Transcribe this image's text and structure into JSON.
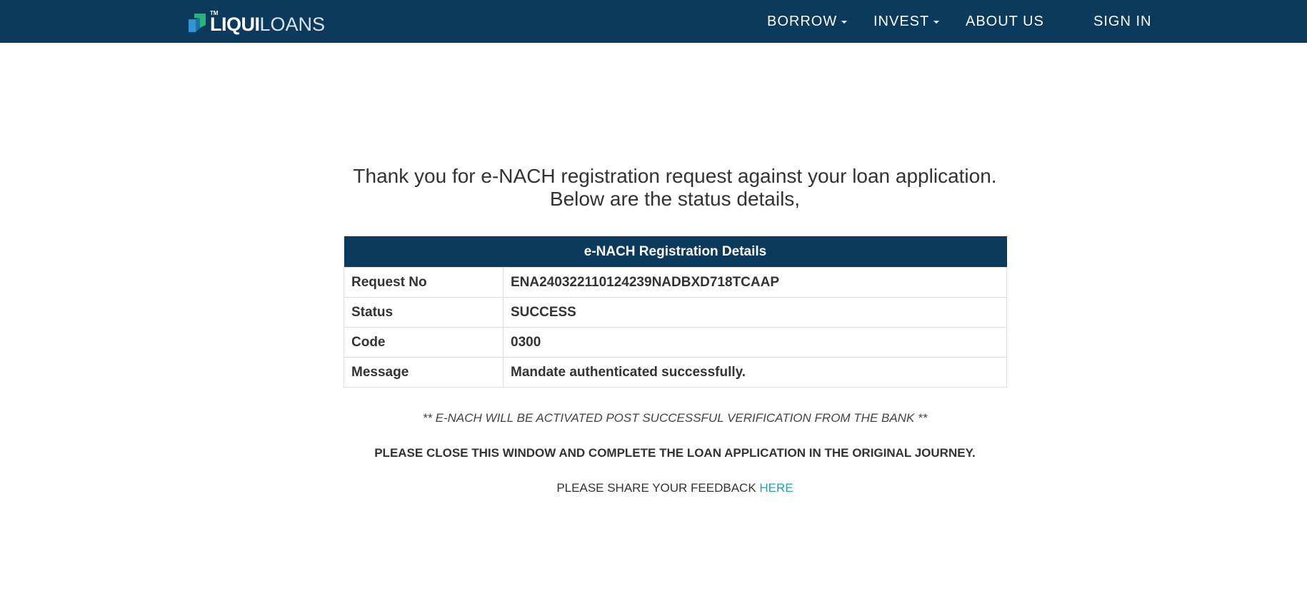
{
  "header": {
    "logo": {
      "tm": "TM",
      "text_bold": "LIQUI",
      "text_thin": "LOANS"
    },
    "nav": {
      "borrow": "BORROW",
      "invest": "INVEST",
      "about": "ABOUT US",
      "signin": "SIGN IN"
    },
    "colors": {
      "navbar_bg": "#0c3a5d",
      "logo_green": "#27b37a",
      "logo_blue": "#2f95d3"
    }
  },
  "main": {
    "heading_line1": "Thank you for e-NACH registration request against your loan application.",
    "heading_line2": "Below are the status details,",
    "table": {
      "title": "e-NACH Registration Details",
      "rows": [
        {
          "label": "Request No",
          "value": "ENA240322110124239NADBXD718TCAAP"
        },
        {
          "label": "Status",
          "value": "SUCCESS"
        },
        {
          "label": "Code",
          "value": "0300"
        },
        {
          "label": "Message",
          "value": "Mandate authenticated successfully."
        }
      ]
    },
    "note_activation": "** E-NACH WILL BE ACTIVATED POST SUCCESSFUL VERIFICATION FROM THE BANK **",
    "note_close": "PLEASE CLOSE THIS WINDOW AND COMPLETE THE LOAN APPLICATION IN THE ORIGINAL JOURNEY.",
    "feedback_text": "PLEASE SHARE YOUR FEEDBACK ",
    "feedback_link": "HERE",
    "link_color": "#1aa3c4"
  }
}
